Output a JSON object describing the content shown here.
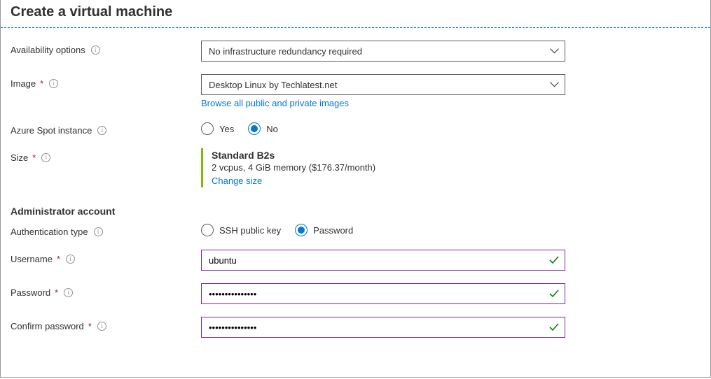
{
  "page_title": "Create a virtual machine",
  "availability": {
    "label": "Availability options",
    "value": "No infrastructure redundancy required"
  },
  "image": {
    "label": "Image",
    "value": "Desktop Linux by Techlatest.net",
    "browse_link": "Browse all public and private images"
  },
  "spot": {
    "label": "Azure Spot instance",
    "opt_yes": "Yes",
    "opt_no": "No"
  },
  "size": {
    "label": "Size",
    "name": "Standard B2s",
    "detail": "2 vcpus, 4 GiB memory ($176.37/month)",
    "change": "Change size"
  },
  "admin": {
    "section": "Administrator account",
    "auth_label": "Authentication type",
    "opt_ssh": "SSH public key",
    "opt_pwd": "Password",
    "username_label": "Username",
    "username_value": "ubuntu",
    "password_label": "Password",
    "password_value": "•••••••••••••••",
    "confirm_label": "Confirm password",
    "confirm_value": "•••••••••••••••"
  }
}
